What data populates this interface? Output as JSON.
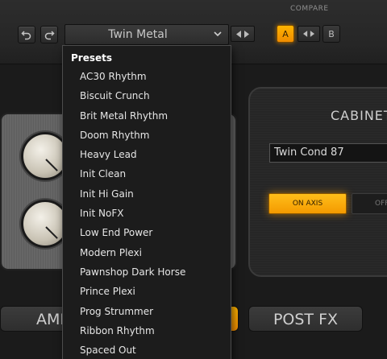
{
  "toolbar": {
    "undo_icon": "undo-icon",
    "redo_icon": "redo-icon",
    "preset_name": "Twin Metal",
    "dropdown_icon": "chevron-down-icon",
    "compare_label": "COMPARE",
    "compare_a": "A",
    "compare_b": "B",
    "accent_color": "#ffa800"
  },
  "preset_menu": {
    "header": "Presets",
    "items": [
      "AC30 Rhythm",
      "Biscuit Crunch",
      "Brit Metal Rhythm",
      "Doom Rhythm",
      "Heavy Lead",
      "Init Clean",
      "Init Hi Gain",
      "Init NoFX",
      "Low End Power",
      "Modern Plexi",
      "Pawnshop Dark Horse",
      "Prince Plexi",
      "Prog Strummer",
      "Ribbon Rhythm",
      "Spaced Out"
    ]
  },
  "cabinet": {
    "title": "CABINET",
    "cab_name": "Twin Cond 87",
    "on_axis_label": "ON AXIS",
    "off_axis_label": "OFF"
  },
  "tabs": {
    "amp_label": "AMP",
    "post_fx_label": "POST FX"
  }
}
